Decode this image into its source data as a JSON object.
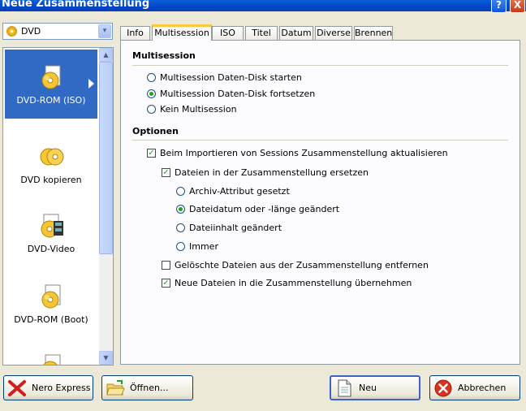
{
  "window": {
    "title": "Neue Zusammenstellung",
    "help_label": "?",
    "close_label": "X"
  },
  "combo": {
    "selected": "DVD",
    "arrow": "▾"
  },
  "left_items": [
    {
      "label": "DVD-ROM (ISO)",
      "icon": "dvd-rom-iso-icon"
    },
    {
      "label": "DVD kopieren",
      "icon": "dvd-copy-icon"
    },
    {
      "label": "DVD-Video",
      "icon": "dvd-video-icon"
    },
    {
      "label": "DVD-ROM (Boot)",
      "icon": "dvd-rom-boot-icon"
    }
  ],
  "scroll": {
    "up": "▲",
    "down": "▼"
  },
  "tabs": [
    "Info",
    "Multisession",
    "ISO",
    "Titel",
    "Datum",
    "Diverse",
    "Brennen"
  ],
  "multisession": {
    "heading": "Multisession",
    "options": [
      "Multisession Daten-Disk starten",
      "Multisession Daten-Disk fortsetzen",
      "Kein Multisession"
    ]
  },
  "optionen": {
    "heading": "Optionen",
    "import_update": "Beim Importieren von Sessions Zusammenstellung aktualisieren",
    "replace_files": "Dateien in der Zusammenstellung ersetzen",
    "replace_options": [
      "Archiv-Attribut gesetzt",
      "Dateidatum oder -länge geändert",
      "Dateiinhalt geändert",
      "Immer"
    ],
    "remove_deleted": "Gelöschte Dateien aus der Zusammenstellung entfernen",
    "add_new": "Neue Dateien in die Zusammenstellung übernehmen"
  },
  "buttons": {
    "nero_express": "Nero Express",
    "open": "Öffnen...",
    "new": "Neu",
    "cancel": "Abbrechen"
  }
}
